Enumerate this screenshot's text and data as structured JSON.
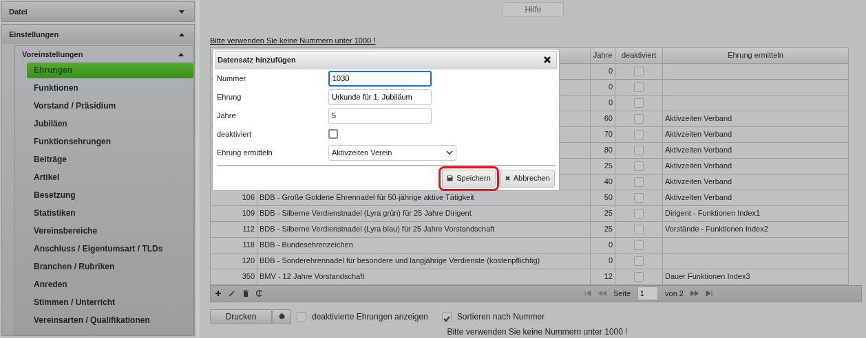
{
  "sidebar": {
    "panels": [
      {
        "title": "Datei",
        "expanded": false
      },
      {
        "title": "Einstellungen",
        "expanded": true,
        "children": [
          {
            "title": "Voreinstellungen",
            "expanded": true,
            "items": [
              {
                "label": "Ehrungen",
                "selected": true
              },
              {
                "label": "Funktionen",
                "selected": false
              },
              {
                "label": "Vorstand / Präsidium",
                "selected": false
              },
              {
                "label": "Jubiläen",
                "selected": false
              },
              {
                "label": "Funktionsehrungen",
                "selected": false
              },
              {
                "label": "Beiträge",
                "selected": false
              },
              {
                "label": "Artikel",
                "selected": false
              },
              {
                "label": "Besetzung",
                "selected": false
              },
              {
                "label": "Statistiken",
                "selected": false
              },
              {
                "label": "Vereinsbereiche",
                "selected": false
              },
              {
                "label": "Anschluss / Eigentumsart / TLDs",
                "selected": false
              },
              {
                "label": "Branchen / Rubriken",
                "selected": false
              },
              {
                "label": "Anreden",
                "selected": false
              },
              {
                "label": "Stimmen / Unterricht",
                "selected": false
              },
              {
                "label": "Vereinsarten / Qualifikationen",
                "selected": false
              }
            ]
          }
        ]
      }
    ]
  },
  "help_button": "Hilfe",
  "notice_link": "Bitte verwenden Sie keine Nummern unter 1000 !",
  "table": {
    "columns": [
      "Jahre",
      "deaktiviert",
      "Ehrung ermitteln"
    ],
    "rows": [
      {
        "jahre": "0",
        "deaktiviert": false
      },
      {
        "jahre": "0",
        "deaktiviert": false
      },
      {
        "jahre": "0",
        "deaktiviert": false
      },
      {
        "jahre": "60",
        "deaktiviert": false,
        "ermitteln": "Aktivzeiten Verband"
      },
      {
        "jahre": "70",
        "deaktiviert": false,
        "ermitteln": "Aktivzeiten Verband"
      },
      {
        "jahre": "80",
        "deaktiviert": false,
        "ermitteln": "Aktivzeiten Verband"
      },
      {
        "jahre": "25",
        "deaktiviert": false,
        "ermitteln": "Aktivzeiten Verband"
      },
      {
        "jahre": "40",
        "deaktiviert": false,
        "ermitteln": "Aktivzeiten Verband"
      },
      {
        "nummer": "106",
        "ehrung": "BDB - Große Goldene Ehrennadel für 50-jährige aktive Tätigkeit",
        "jahre": "50",
        "deaktiviert": false,
        "ermitteln": "Aktivzeiten Verband"
      },
      {
        "nummer": "109",
        "ehrung": "BDB - Silberne Verdienstnadel (Lyra grün) für 25 Jahre Dirigent",
        "jahre": "25",
        "deaktiviert": false,
        "ermitteln": "Dirigent - Funktionen Index1"
      },
      {
        "nummer": "112",
        "ehrung": "BDB - Silberne Verdienstnadel (Lyra blau) für 25 Jahre Vorstandschaft",
        "jahre": "25",
        "deaktiviert": false,
        "ermitteln": "Vorstände - Funktionen Index2"
      },
      {
        "nummer": "118",
        "ehrung": "BDB - Bundesehrenzeichen",
        "jahre": "0",
        "deaktiviert": false
      },
      {
        "nummer": "120",
        "ehrung": "BDB - Sonderehrennadel für besondere und langjährige Verdienste (kostenpflichtig)",
        "jahre": "0",
        "deaktiviert": false
      },
      {
        "nummer": "350",
        "ehrung": "BMV - 12 Jahre Vorstandschaft",
        "jahre": "12",
        "deaktiviert": false,
        "ermitteln": "Dauer Funktionen Index3"
      }
    ]
  },
  "pager": {
    "page_label": "Seite",
    "page": "1",
    "total": "von 2"
  },
  "dialog": {
    "title": "Datensatz hinzufügen",
    "fields": [
      {
        "kind": "text",
        "label": "Nummer",
        "value": "1030",
        "focused": true
      },
      {
        "kind": "text",
        "label": "Ehrung",
        "value": "Urkunde für 1. Jubiläum",
        "focused": false
      },
      {
        "kind": "text",
        "label": "Jahre",
        "value": "5",
        "focused": false
      },
      {
        "kind": "checkbox",
        "label": "deaktiviert",
        "checked": false
      },
      {
        "kind": "select",
        "label": "Ehrung ermitteln",
        "value": "Aktivzeiten Verein"
      }
    ],
    "buttons": [
      {
        "kind": "save",
        "label": "Speichern",
        "highlighted": true
      },
      {
        "kind": "cancel",
        "label": "Abbrechen",
        "highlighted": false
      }
    ]
  },
  "bottom": {
    "print_button": "Drucken",
    "options": [
      {
        "label": "deaktivierte Ehrungen anzeigen",
        "checked": false
      },
      {
        "label": "Sortieren nach Nummer",
        "checked": true
      }
    ]
  },
  "footer_note": "Bitte verwenden Sie keine Nummern unter 1000 !"
}
